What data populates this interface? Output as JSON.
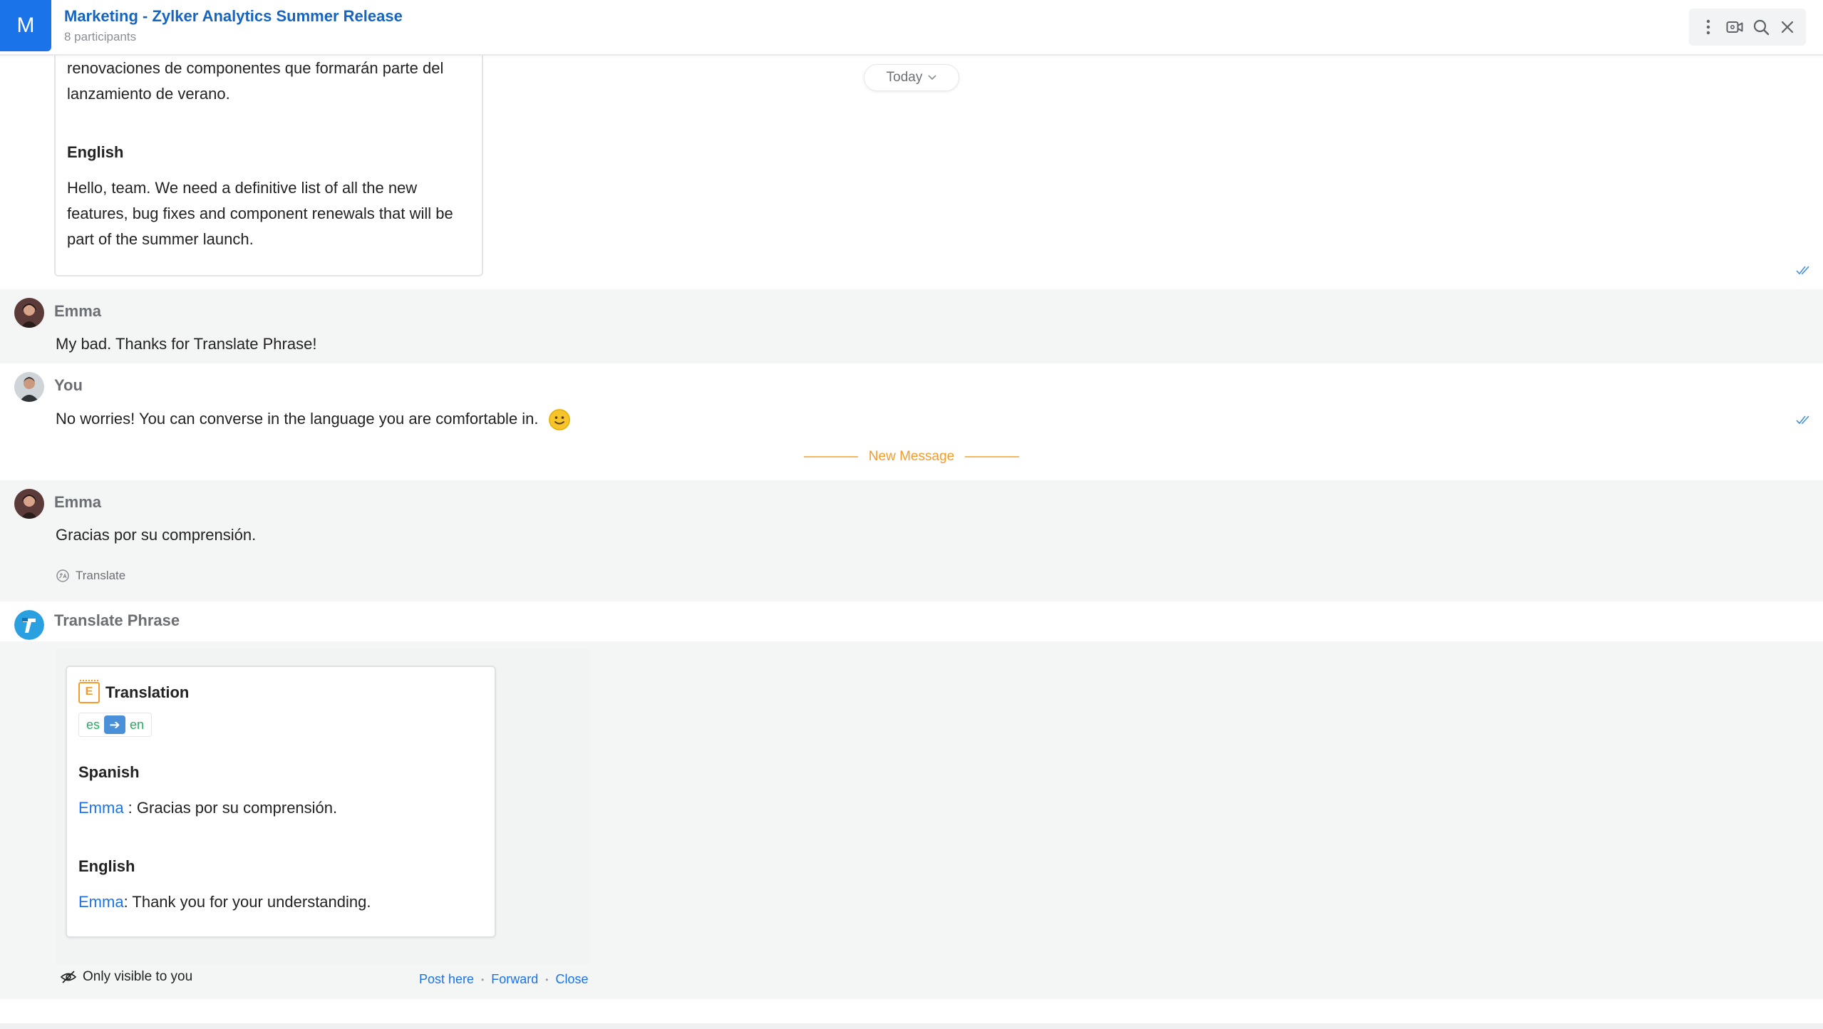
{
  "header": {
    "avatar_letter": "M",
    "title": "Marketing - Zylker Analytics Summer Release",
    "subtitle": "8 participants",
    "tools": [
      "more-options-icon",
      "video-call-icon",
      "search-icon",
      "close-icon"
    ]
  },
  "date_pill": {
    "label": "Today"
  },
  "prev_card": {
    "spanish_tail_1": "renovaciones de componentes que formarán parte del",
    "spanish_tail_2": "lanzamiento de verano.",
    "english_heading": "English",
    "english_line_1": "Hello, team. We need a definitive list of all the new",
    "english_line_2": "features, bug fixes and component renewals that will be",
    "english_line_3": "part of the summer launch."
  },
  "messages": [
    {
      "sender": "Emma",
      "text": "My bad. Thanks for Translate Phrase!"
    },
    {
      "sender": "You",
      "text": "No worries! You can converse in the language you are comfortable in.",
      "emoji": "🙂"
    }
  ],
  "new_message_divider": "New Message",
  "emma_message": {
    "sender": "Emma",
    "text": "Gracias por su comprensión.",
    "translate_label": "Translate"
  },
  "bot": {
    "name": "Translate Phrase",
    "card_title": "Translation",
    "card_icon_letter": "E",
    "lang_from": "es",
    "lang_to": "en",
    "spanish_heading": "Spanish",
    "spanish_name": "Emma",
    "spanish_text": " : Gracias por su comprensión.",
    "english_heading": "English",
    "english_name": "Emma",
    "english_text": ": Thank you for your understanding.",
    "visibility_note": "Only visible to you",
    "actions": [
      "Post here",
      "Forward",
      "Close"
    ]
  },
  "colors": {
    "accent": "#1a73e8",
    "new_message": "#f39c2b",
    "gray_bg": "#f4f5f5"
  }
}
